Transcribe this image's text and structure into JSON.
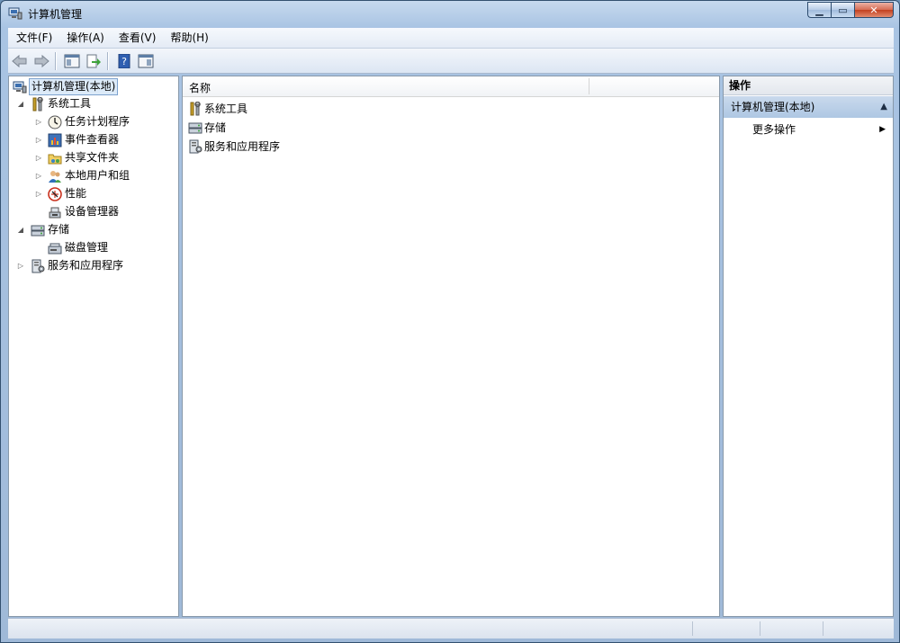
{
  "window": {
    "title": "计算机管理",
    "controls": [
      "minimize",
      "maximize",
      "close"
    ]
  },
  "menubar": {
    "items": [
      "文件(F)",
      "操作(A)",
      "查看(V)",
      "帮助(H)"
    ]
  },
  "toolbar": {
    "buttons": [
      "back",
      "forward",
      "show-hide-console-tree",
      "export-list",
      "help",
      "show-hide-action-pane"
    ]
  },
  "tree": {
    "root": "计算机管理(本地)",
    "items": [
      {
        "label": "系统工具",
        "icon": "tools-icon",
        "expanded": true
      },
      {
        "label": "任务计划程序",
        "icon": "clock-icon"
      },
      {
        "label": "事件查看器",
        "icon": "event-viewer-icon"
      },
      {
        "label": "共享文件夹",
        "icon": "shared-folder-icon"
      },
      {
        "label": "本地用户和组",
        "icon": "users-icon"
      },
      {
        "label": "性能",
        "icon": "performance-icon"
      },
      {
        "label": "设备管理器",
        "icon": "device-manager-icon"
      },
      {
        "label": "存储",
        "icon": "storage-icon",
        "expanded": true
      },
      {
        "label": "磁盘管理",
        "icon": "disk-icon"
      },
      {
        "label": "服务和应用程序",
        "icon": "services-icon"
      }
    ]
  },
  "list": {
    "column_name": "名称",
    "rows": [
      "系统工具",
      "存储",
      "服务和应用程序"
    ]
  },
  "actions": {
    "header": "操作",
    "group": "计算机管理(本地)",
    "more": "更多操作"
  },
  "colors": {
    "selection_border": "#7da2ce",
    "selection_fill": "#dceaf8",
    "action_group": "#b8cee7"
  }
}
